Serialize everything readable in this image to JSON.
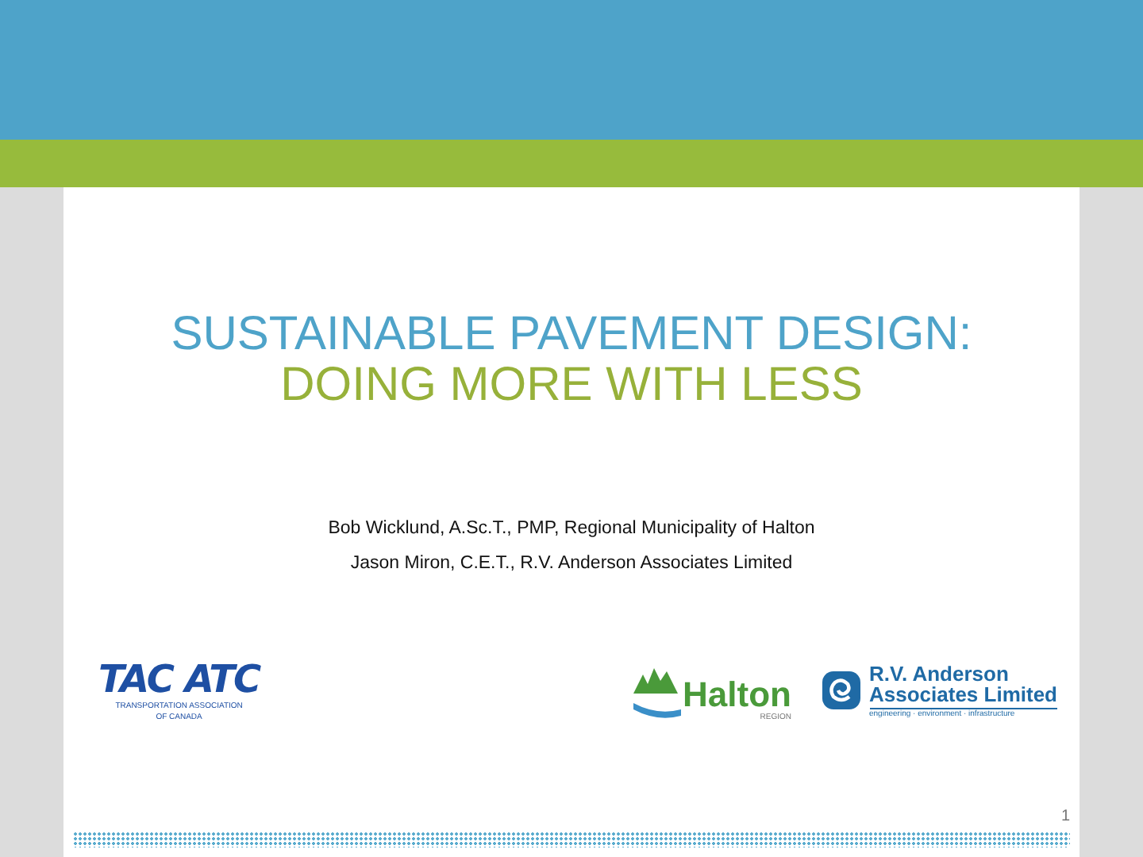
{
  "title": {
    "line_1": "SUSTAINABLE PAVEMENT DESIGN:",
    "line_2": "DOING MORE WITH LESS"
  },
  "authors": [
    "Bob Wicklund, A.Sc.T., PMP, Regional Municipality of Halton",
    "Jason Miron, C.E.T., R.V. Anderson Associates Limited"
  ],
  "logos": {
    "tac": {
      "mark": "TAC ATC",
      "caption_1": "TRANSPORTATION ASSOCIATION",
      "caption_2": "OF CANADA"
    },
    "halton": {
      "name": "Halton",
      "sub": "REGION"
    },
    "rva": {
      "line_1": "R.V. Anderson",
      "line_2": "Associates Limited",
      "tagline": "engineering · environment · infrastructure"
    }
  },
  "slide_number": "1"
}
